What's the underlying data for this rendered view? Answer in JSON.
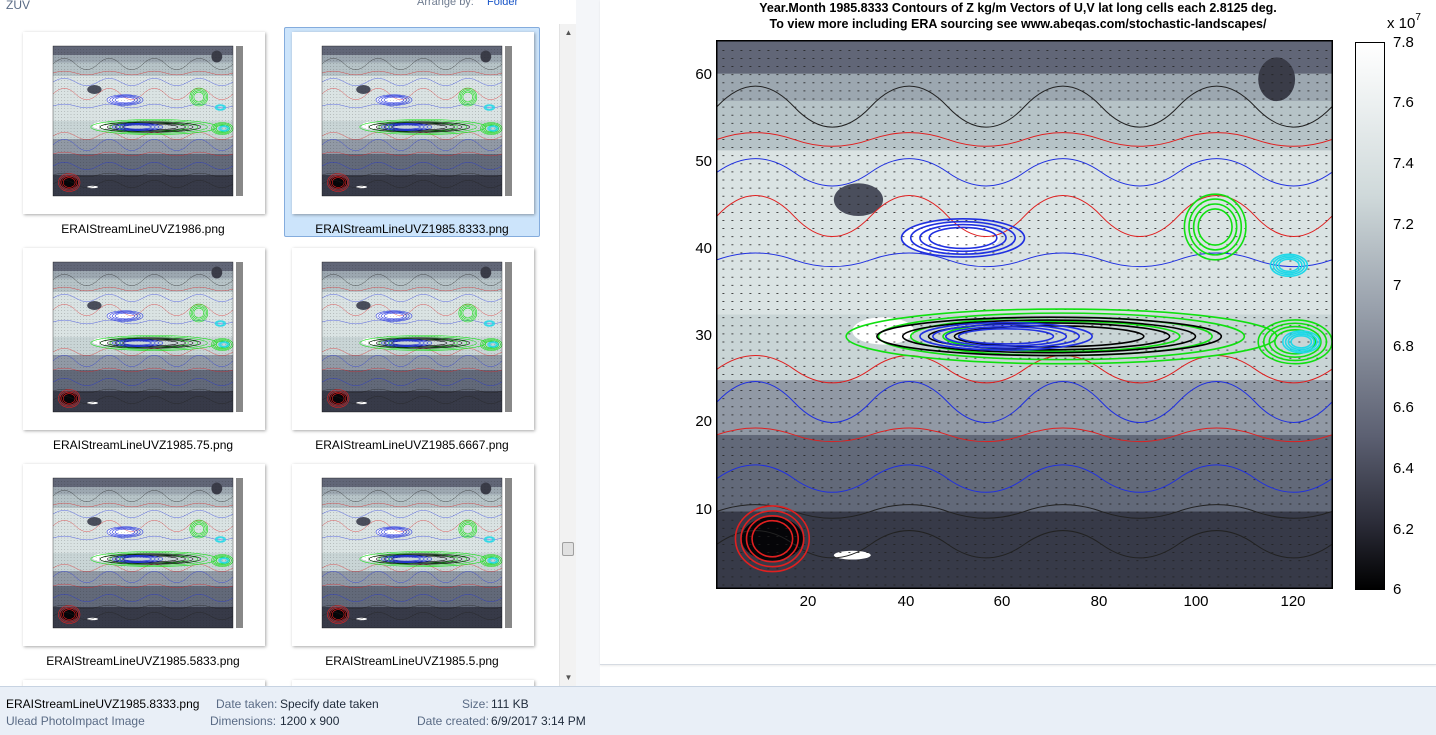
{
  "explorer": {
    "folder_name": "ZUV",
    "arrange_by_label": "Arrange by:",
    "arrange_by_value": "Folder"
  },
  "files": [
    {
      "name": "ERAIStreamLineUVZ1986.png",
      "selected": false
    },
    {
      "name": "ERAIStreamLineUVZ1985.8333.png",
      "selected": true
    },
    {
      "name": "ERAIStreamLineUVZ1985.75.png",
      "selected": false
    },
    {
      "name": "ERAIStreamLineUVZ1985.6667.png",
      "selected": false
    },
    {
      "name": "ERAIStreamLineUVZ1985.5833.png",
      "selected": false
    },
    {
      "name": "ERAIStreamLineUVZ1985.5.png",
      "selected": false
    }
  ],
  "preview": {
    "title_line1": "Year.Month  1985.8333  Contours of Z kg/m  Vectors of U,V  lat long cells each 2.8125 deg.",
    "title_line2": "To view more including ERA sourcing see www.abeqas.com/stochastic-landscapes/",
    "y_ticks": [
      "60",
      "50",
      "40",
      "30",
      "20",
      "10"
    ],
    "x_ticks": [
      "20",
      "40",
      "60",
      "80",
      "100",
      "120"
    ],
    "colorbar": {
      "multiplier": "x 10",
      "exponent": "7",
      "ticks": [
        "7.8",
        "7.6",
        "7.4",
        "7.2",
        "7",
        "6.8",
        "6.6",
        "6.4",
        "6.2",
        "6"
      ]
    }
  },
  "details": {
    "file_name": "ERAIStreamLineUVZ1985.8333.png",
    "file_type": "Ulead PhotoImpact Image",
    "date_taken_label": "Date taken:",
    "date_taken_value": "Specify date taken",
    "dimensions_label": "Dimensions:",
    "dimensions_value": "1200 x 900",
    "size_label": "Size:",
    "size_value": "111 KB",
    "date_created_label": "Date created:",
    "date_created_value": "6/9/2017 3:14 PM"
  },
  "colors": {
    "selection_bg": "#cce4fb",
    "selection_border": "#84acdd",
    "details_bg": "#e9eff7",
    "contour_red": "#e02020",
    "contour_blue": "#2030e0",
    "contour_green": "#10e010",
    "contour_cyan": "#20d8e8"
  }
}
